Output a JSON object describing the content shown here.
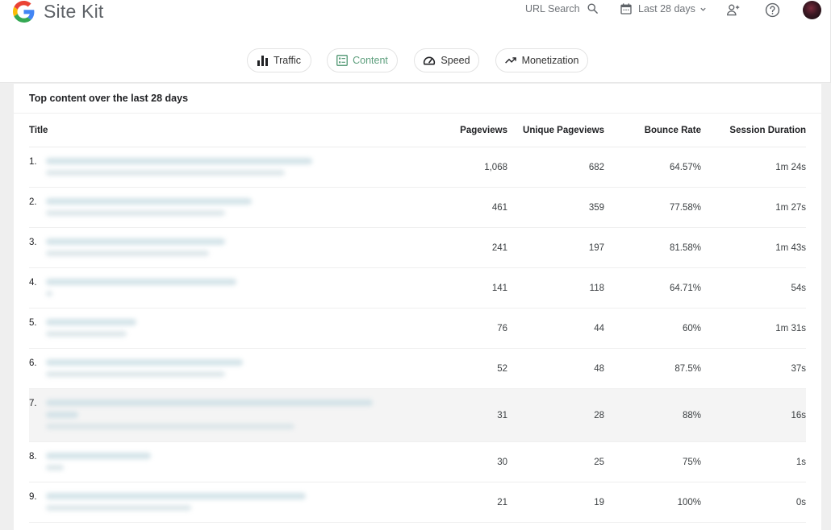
{
  "header": {
    "brand_name": "Site Kit",
    "url_search_label": "URL Search",
    "date_range_label": "Last 28 days"
  },
  "tabs": [
    {
      "label": "Traffic",
      "icon": "bar-chart-icon",
      "active": false
    },
    {
      "label": "Content",
      "icon": "list-icon",
      "active": true
    },
    {
      "label": "Speed",
      "icon": "speedometer-icon",
      "active": false
    },
    {
      "label": "Monetization",
      "icon": "trending-up-icon",
      "active": false
    }
  ],
  "colors": {
    "active_tab": "#5c9e7c",
    "page_background": "#efefef",
    "highlight_row": "#f4f4f4"
  },
  "card": {
    "title": "Top content over the last 28 days"
  },
  "table": {
    "columns": [
      "Title",
      "Pageviews",
      "Unique Pageviews",
      "Bounce Rate",
      "Session Duration"
    ],
    "rows": [
      {
        "rank": "1.",
        "title": "[blurred]",
        "pageviews": "1,068",
        "unique_pageviews": "682",
        "bounce_rate": "64.57%",
        "session_duration": "1m 24s"
      },
      {
        "rank": "2.",
        "title": "[blurred]",
        "pageviews": "461",
        "unique_pageviews": "359",
        "bounce_rate": "77.58%",
        "session_duration": "1m 27s"
      },
      {
        "rank": "3.",
        "title": "[blurred]",
        "pageviews": "241",
        "unique_pageviews": "197",
        "bounce_rate": "81.58%",
        "session_duration": "1m 43s"
      },
      {
        "rank": "4.",
        "title": "[blurred]",
        "pageviews": "141",
        "unique_pageviews": "118",
        "bounce_rate": "64.71%",
        "session_duration": "54s"
      },
      {
        "rank": "5.",
        "title": "[blurred]",
        "pageviews": "76",
        "unique_pageviews": "44",
        "bounce_rate": "60%",
        "session_duration": "1m 31s"
      },
      {
        "rank": "6.",
        "title": "[blurred]",
        "pageviews": "52",
        "unique_pageviews": "48",
        "bounce_rate": "87.5%",
        "session_duration": "37s"
      },
      {
        "rank": "7.",
        "title": "[blurred]",
        "pageviews": "31",
        "unique_pageviews": "28",
        "bounce_rate": "88%",
        "session_duration": "16s"
      },
      {
        "rank": "8.",
        "title": "[blurred]",
        "pageviews": "30",
        "unique_pageviews": "25",
        "bounce_rate": "75%",
        "session_duration": "1s"
      },
      {
        "rank": "9.",
        "title": "[blurred]",
        "pageviews": "21",
        "unique_pageviews": "19",
        "bounce_rate": "100%",
        "session_duration": "0s"
      }
    ]
  }
}
